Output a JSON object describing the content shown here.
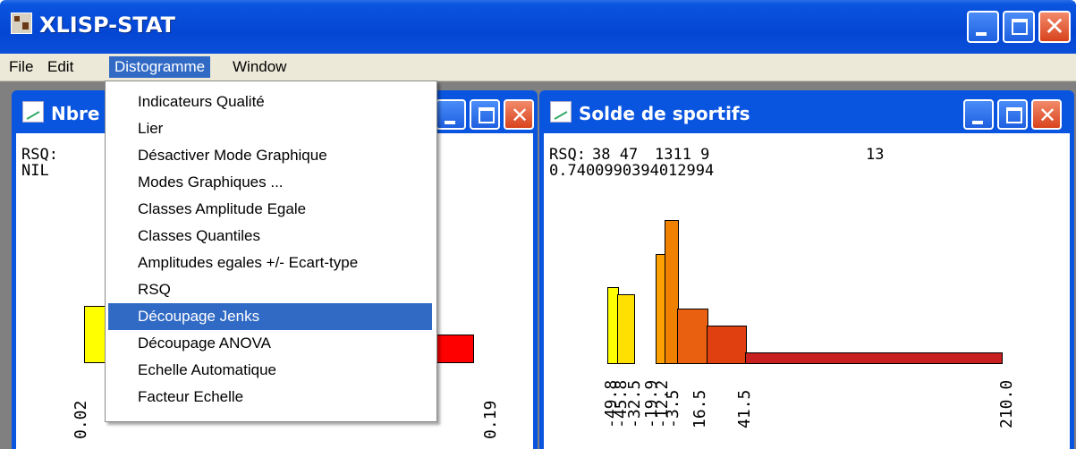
{
  "app": {
    "title": "XLISP-STAT"
  },
  "menubar": [
    {
      "label": "File",
      "active": false
    },
    {
      "label": "Edit",
      "active": false
    },
    {
      "label": "Distogramme",
      "active": true
    },
    {
      "label": "Window",
      "active": false
    }
  ],
  "menu": {
    "items": [
      "Indicateurs Qualité",
      "Lier",
      "Désactiver Mode Graphique",
      "Modes Graphiques ...",
      "Classes Amplitude Egale",
      "Classes Quantiles",
      "Amplitudes egales +/- Ecart-type",
      "RSQ",
      "Découpage Jenks",
      "Découpage ANOVA",
      "Echelle Automatique",
      "Facteur Echelle"
    ],
    "highlighted_index": 8
  },
  "window_left": {
    "title": "Nbre",
    "rsq_label": "RSQ:",
    "rsq_value": "NIL",
    "tick_first": "0.02",
    "tick_last": "0.19",
    "bar_colors": [
      "#ffff00",
      "#ff0000"
    ]
  },
  "window_right": {
    "title": "Solde de sportifs",
    "rsq_label": "RSQ:",
    "header_numbers": "38 47",
    "header_numbers2": "1311 9",
    "header_numbers3": "13",
    "rsq_value": "0.7400990394012994",
    "ticks": [
      "-49.8",
      "-45.8",
      "-32.5",
      "-19.9",
      "-12.2",
      "-3.5",
      "16.5",
      "41.5",
      "210.0"
    ],
    "colors": [
      "#ffff00",
      "#ffe000",
      "#ffc000",
      "#ffa000",
      "#f08000",
      "#e86010",
      "#e04010",
      "#c82020"
    ]
  }
}
